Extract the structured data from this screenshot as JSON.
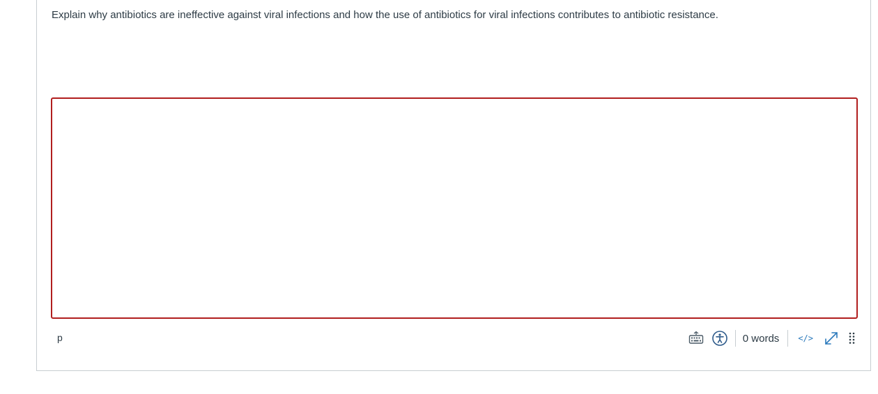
{
  "question": {
    "prompt": "Explain why antibiotics are ineffective against viral infections and how the use of antibiotics for viral infections contributes to antibiotic resistance."
  },
  "editor": {
    "content": ""
  },
  "status_bar": {
    "element_path": "p",
    "word_count": "0 words",
    "html_toggle": "</>",
    "icons": {
      "keyboard": "keyboard-icon",
      "accessibility": "accessibility-icon",
      "fullscreen": "expand-icon",
      "resize": "drag-handle-icon"
    }
  },
  "colors": {
    "text": "#2d3b45",
    "error_border": "#b11e1e",
    "link": "#2b7abc",
    "divider": "#c7cdd1"
  }
}
